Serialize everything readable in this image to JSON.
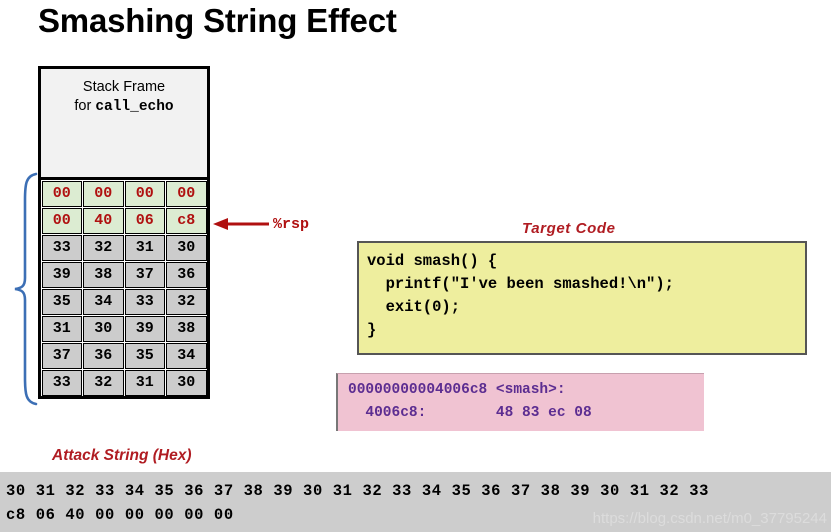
{
  "title": "Smashing String Effect",
  "stack": {
    "frame_header_line1": "Stack Frame",
    "frame_header_line2_prefix": "for ",
    "frame_header_line2_mono": "call_echo",
    "rows": [
      {
        "fill": "green",
        "cells": [
          "00",
          "00",
          "00",
          "00"
        ]
      },
      {
        "fill": "green",
        "cells": [
          "00",
          "40",
          "06",
          "c8"
        ]
      },
      {
        "fill": "gray",
        "cells": [
          "33",
          "32",
          "31",
          "30"
        ]
      },
      {
        "fill": "gray",
        "cells": [
          "39",
          "38",
          "37",
          "36"
        ]
      },
      {
        "fill": "gray",
        "cells": [
          "35",
          "34",
          "33",
          "32"
        ]
      },
      {
        "fill": "gray",
        "cells": [
          "31",
          "30",
          "39",
          "38"
        ]
      },
      {
        "fill": "gray",
        "cells": [
          "37",
          "36",
          "35",
          "34"
        ]
      },
      {
        "fill": "gray",
        "cells": [
          "33",
          "32",
          "31",
          "30"
        ]
      }
    ],
    "green_fill": "#dcecd2",
    "green_text": "#b01010",
    "gray_fill": "#cccccc",
    "gray_text": "#000000",
    "header_fill": "#f2f2f2"
  },
  "rsp": {
    "label": "%rsp",
    "color": "#b01010"
  },
  "brace": {
    "color": "#3c6fb5"
  },
  "attack_string": {
    "label": "Attack String (Hex)",
    "color": "#b01c22"
  },
  "target_code": {
    "label": "Target Code",
    "label_color": "#b01c22",
    "box_fill": "#eeee9e",
    "code": "void smash() {\n  printf(\"I've been smashed!\\n\");\n  exit(0);\n}"
  },
  "disassembly": {
    "box_fill": "#f0c3d2",
    "text_color": "#5c2d91",
    "line1": "00000000004006c8 <smash>:",
    "line2": "  4006c8:        48 83 ec 08"
  },
  "hex_banner": {
    "background": "#cdcdcd",
    "row1": "30 31 32 33 34 35 36 37 38 39 30 31 32 33 34 35 36 37 38 39 30 31 32 33",
    "row2": "c8 06 40 00 00 00 00 00"
  },
  "watermark": {
    "text": "https://blog.csdn.net/m0_37795244",
    "color": "#dcdcdc"
  }
}
